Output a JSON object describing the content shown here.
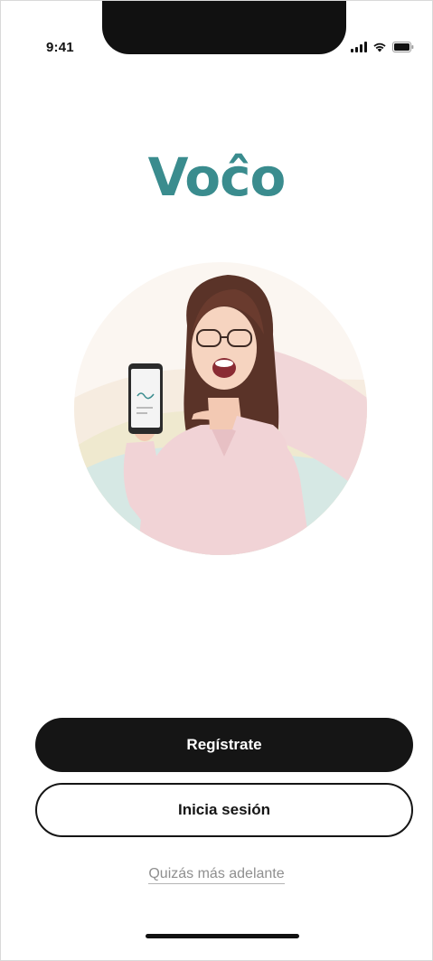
{
  "status_bar": {
    "time": "9:41",
    "icons": [
      "signal-icon",
      "wifi-icon",
      "battery-icon"
    ]
  },
  "brand": {
    "logo_text": "Voĉo",
    "color": "#3a8c8e"
  },
  "hero": {
    "image": "woman-holding-phone-illustration"
  },
  "actions": {
    "register_label": "Regístrate",
    "login_label": "Inicia sesión",
    "later_label": "Quizás más adelante"
  },
  "colors": {
    "primary_button": "#151515",
    "secondary_text": "#8f8f8f",
    "background": "#ffffff"
  }
}
